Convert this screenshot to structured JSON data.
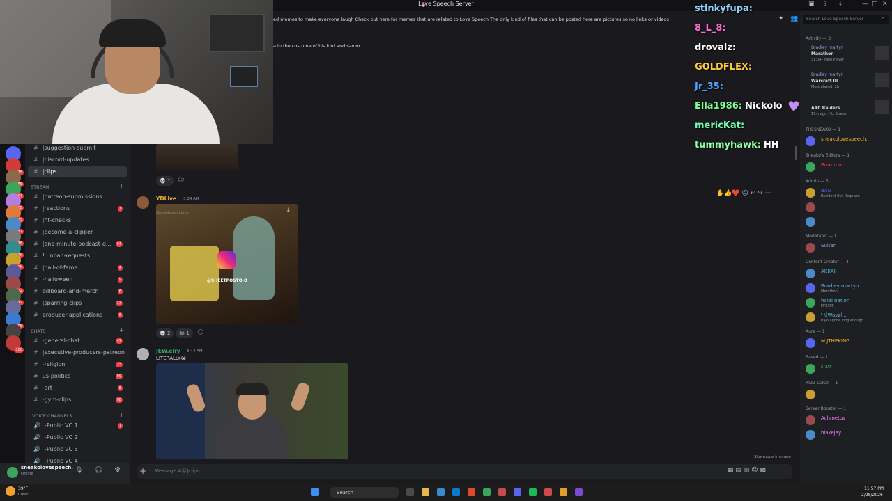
{
  "window": {
    "title": "Love Speech Server"
  },
  "top_banner": {
    "line1": "ed memes to make everyone laugh Check out here for memes that are related to Love Speech The only kind of files that can be posted here are pictures so no links or videos ⚠️⚠️Specifically, The LOVE SPEECH Server DOES...",
    "line2": "a in the costume of his lord and savior"
  },
  "servers": [
    {
      "badge": ""
    },
    {
      "badge": "75"
    },
    {
      "badge": "65"
    },
    {
      "badge": "294"
    },
    {
      "badge": "88"
    },
    {
      "badge": "235"
    },
    {
      "badge": "57"
    },
    {
      "badge": "36"
    },
    {
      "badge": "870"
    },
    {
      "badge": "3.1K"
    },
    {
      "badge": ""
    },
    {
      "badge": "512"
    },
    {
      "badge": "42"
    },
    {
      "badge": ""
    },
    {
      "badge": "505"
    },
    {
      "badge": ""
    },
    {
      "badge": "180"
    }
  ],
  "channels": {
    "top": [
      {
        "name": "|suggestion-submit",
        "count": ""
      },
      {
        "name": "|discord-updates",
        "count": ""
      },
      {
        "name": "|clips",
        "count": ""
      }
    ],
    "stream_label": "STREAM",
    "stream": [
      {
        "name": "|patreon-submissions",
        "count": ""
      },
      {
        "name": "|reactions",
        "count": "1"
      },
      {
        "name": "|fit-checks",
        "count": ""
      },
      {
        "name": "|become-a-clipper",
        "count": ""
      },
      {
        "name": "|one-minute-podcast-q...",
        "count": "94"
      },
      {
        "name": "! unban-requests",
        "count": ""
      },
      {
        "name": "|hall-of-fame",
        "count": "4"
      },
      {
        "name": "-halloween",
        "count": "9"
      },
      {
        "name": "billboard-and-merch",
        "count": "6"
      },
      {
        "name": "|sparring-clips",
        "count": "17"
      },
      {
        "name": "producer-applications",
        "count": "6"
      }
    ],
    "chats_label": "CHATS",
    "chats": [
      {
        "name": "-general-chat",
        "count": "47"
      },
      {
        "name": "|executive-producers-patreon",
        "count": ""
      },
      {
        "name": "-religion",
        "count": "23"
      },
      {
        "name": "us-politics",
        "count": "99"
      },
      {
        "name": "-art",
        "count": "8"
      },
      {
        "name": "-gym-clips",
        "count": "98"
      }
    ],
    "voice_label": "VOICE CHANNELS",
    "voice": [
      {
        "name": "-Public VC 1",
        "count": "7"
      },
      {
        "name": "-Public VC 2",
        "count": ""
      },
      {
        "name": "-Public VC 3",
        "count": ""
      },
      {
        "name": "-Public VC 4",
        "count": ""
      }
    ]
  },
  "user": {
    "name": "sneakolovespeech.",
    "status": "Online"
  },
  "messages": [
    {
      "author": "YDLive",
      "time": "3:34 AM",
      "text": "",
      "media_caption": "@SHEETPOSTO.O",
      "media_top": "@sheetpostingone",
      "reactions": [
        {
          "emoji": "💀",
          "count": "2"
        },
        {
          "emoji": "😂",
          "count": "1"
        }
      ]
    },
    {
      "author": "JEW.elry",
      "time": "3:44 AM",
      "text": "LITERALLY😭",
      "reactions": []
    }
  ],
  "prev_reactions": [
    {
      "emoji": "💀",
      "count": "1"
    }
  ],
  "composer": {
    "placeholder": "Message #😡|clips",
    "slowmode": "Slowmode Immune"
  },
  "stream_chat": [
    {
      "user": "stinkyfupa:",
      "text": "",
      "color": "#8fd3ff"
    },
    {
      "user": "8_L_8:",
      "text": "",
      "color": "#ff6ad5"
    },
    {
      "user": "drovalz:",
      "text": "",
      "color": "#ffffff"
    },
    {
      "user": "GOLDFLEX:",
      "text": "",
      "color": "#ffc83d"
    },
    {
      "user": "Jr_35:",
      "text": "",
      "color": "#4aa3ff"
    },
    {
      "user": "Ella1986:",
      "text": "Nickolo",
      "color": "#7dff9a"
    },
    {
      "user": "mericKat:",
      "text": "",
      "color": "#6dffb0"
    },
    {
      "user": "tummyhawk:",
      "text": "HH",
      "color": "#8effa1"
    }
  ],
  "members": {
    "search_placeholder": "Search Love Speech Server",
    "activity_label": "Activity — 3",
    "activity": [
      {
        "name": "Bradley martyn",
        "game": "Marathon",
        "detail": "31:04 · New Player"
      },
      {
        "name": "Bradley martyn",
        "game": "Warcraft III",
        "detail": "Most played: 2h"
      },
      {
        "name": "",
        "game": "ARC Raiders",
        "detail": "15m ago · 9x Streak"
      }
    ],
    "groups": [
      {
        "label": "THESNEAKO — 1",
        "members": [
          {
            "name": "sneakolovespeech.",
            "sub": "",
            "color": "#f0b232"
          }
        ]
      },
      {
        "label": "Sneako's Editors — 1",
        "members": [
          {
            "name": "Bmmmm",
            "sub": "",
            "color": "#f23f43"
          }
        ]
      },
      {
        "label": "Admin — 3",
        "members": [
          {
            "name": "BAU",
            "sub": "Resident Evil Requiem",
            "color": "#5865f2"
          },
          {
            "name": "",
            "sub": "",
            "color": "#5865f2"
          },
          {
            "name": "",
            "sub": "",
            "color": "#5865f2"
          }
        ]
      },
      {
        "label": "Moderator — 1",
        "members": [
          {
            "name": "Sultan",
            "sub": "",
            "color": "#8ea1e1"
          }
        ]
      },
      {
        "label": "Content Creator — 4",
        "members": [
          {
            "name": "AKKAII",
            "sub": "",
            "color": "#5ab4e0"
          },
          {
            "name": "Bradley martyn",
            "sub": "Marathon",
            "color": "#5ab4e0"
          },
          {
            "name": "halal nation",
            "sub": "PPSSPP",
            "color": "#5ab4e0"
          },
          {
            "name": "\\ \\(Wayzl...",
            "sub": "If you gone long enough",
            "color": "#5ab4e0"
          }
        ]
      },
      {
        "label": "Aura — 1",
        "members": [
          {
            "name": "M JTHEKING",
            "sub": "",
            "color": "#f0b232"
          }
        ]
      },
      {
        "label": "Based — 1",
        "members": [
          {
            "name": "slatt",
            "sub": "",
            "color": "#3ba55c"
          }
        ]
      },
      {
        "label": "RIZZ LORD — 1",
        "members": [
          {
            "name": "",
            "sub": "",
            "color": "#5865f2"
          }
        ]
      },
      {
        "label": "Server Booster — 1",
        "members": [
          {
            "name": "Achmetus",
            "sub": "",
            "color": "#f47fff"
          },
          {
            "name": "blakejay",
            "sub": "",
            "color": "#f47fff"
          }
        ]
      }
    ]
  },
  "taskbar": {
    "weather_temp": "39°F",
    "weather_desc": "Clear",
    "search": "Search",
    "time": "11:57 PM",
    "date": "2/28/2026"
  },
  "colors": {
    "accent": "#5865f2",
    "danger": "#f23f43",
    "online": "#3ba55c"
  }
}
